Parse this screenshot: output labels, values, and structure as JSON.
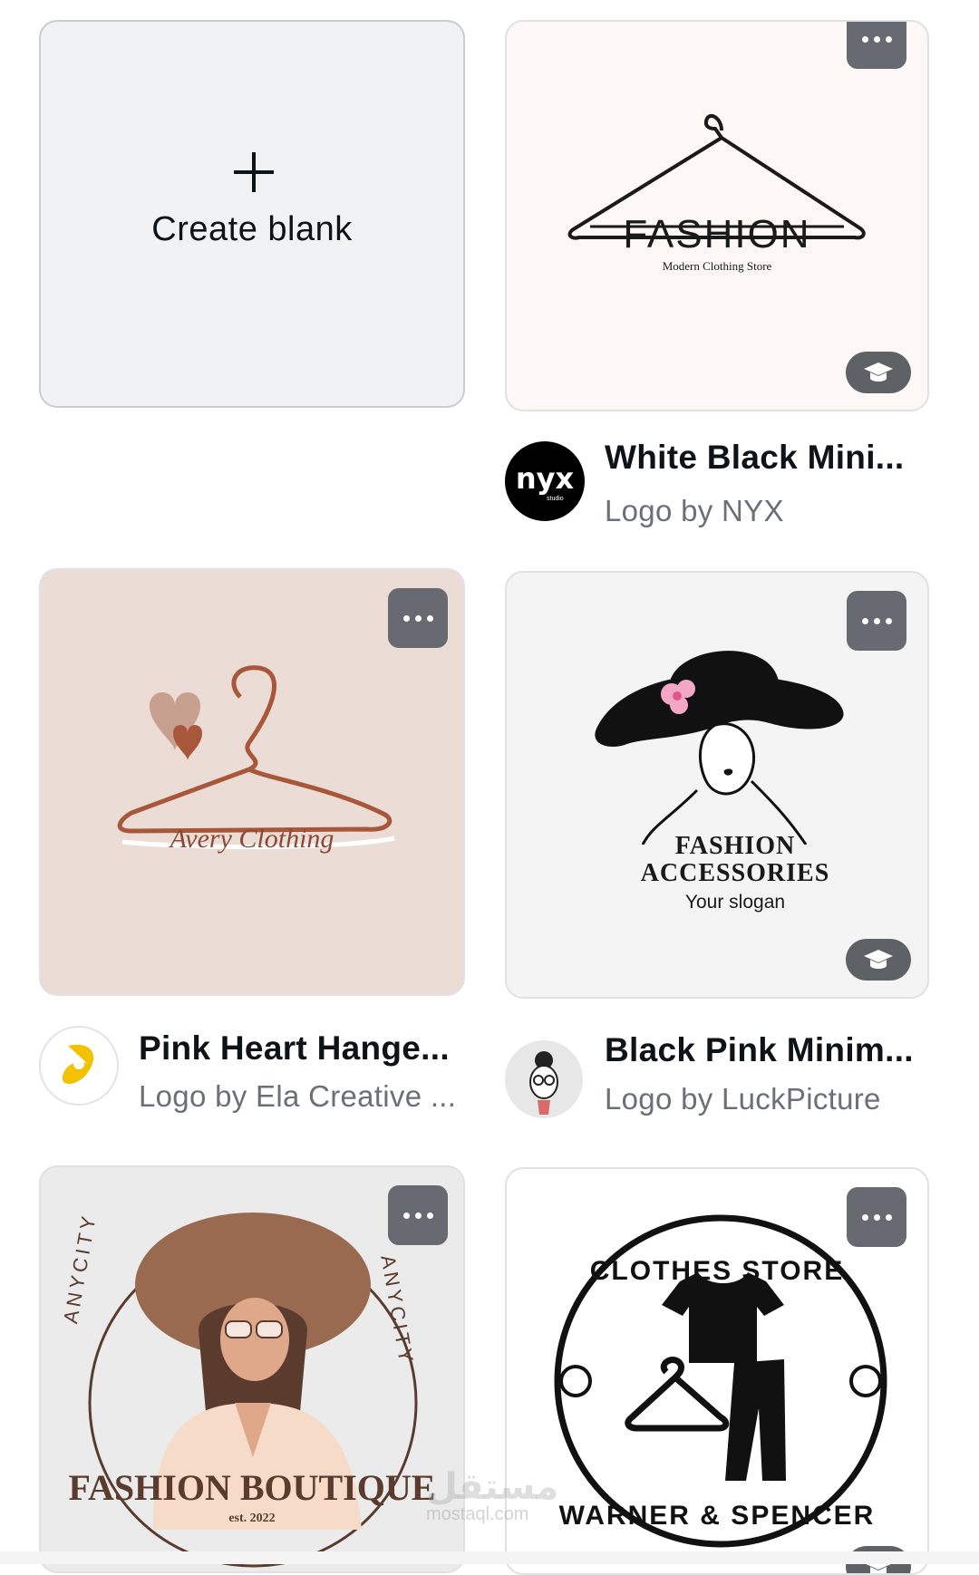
{
  "create_blank": {
    "label": "Create blank",
    "icon": "plus-icon"
  },
  "templates": [
    {
      "title": "White Black Mini...",
      "author": "Logo by NYX",
      "avatar_text": "nyx",
      "avatar_sub": "studio",
      "premium": true,
      "art": {
        "word": "FASHION",
        "tagline": "Modern Clothing Store",
        "bg": "#fdf7f6"
      }
    },
    {
      "title": "Pink Heart Hange...",
      "author": "Logo by Ela Creative ...",
      "premium": false,
      "art": {
        "word": "Avery Clothing",
        "bg": "#ecdcd6"
      }
    },
    {
      "title": "Black Pink Minim...",
      "author": "Logo by LuckPicture",
      "premium": true,
      "art": {
        "line1": "FASHION",
        "line2": "ACCESSORIES",
        "slogan": "Your slogan",
        "bg": "#f4f4f4"
      }
    },
    {
      "title": "",
      "author": "",
      "premium": false,
      "art": {
        "ring_left": "ANYCITY",
        "ring_right": "ANYCITY",
        "word": "FASHION BOUTIQUE",
        "est": "est. 2022",
        "bg": "#ebebeb"
      }
    },
    {
      "title": "",
      "author": "",
      "premium": true,
      "art": {
        "top_arc": "CLOTHES STORE",
        "bottom_arc": "WARNER & SPENCER",
        "bg": "#ffffff"
      }
    }
  ],
  "watermark": {
    "arabic": "مستقل",
    "latin": "mostaql.com"
  },
  "colors": {
    "more_button": "#676a70",
    "premium_badge": "#5e6166",
    "text_primary": "#0e1318",
    "text_secondary": "#6b6f76"
  }
}
